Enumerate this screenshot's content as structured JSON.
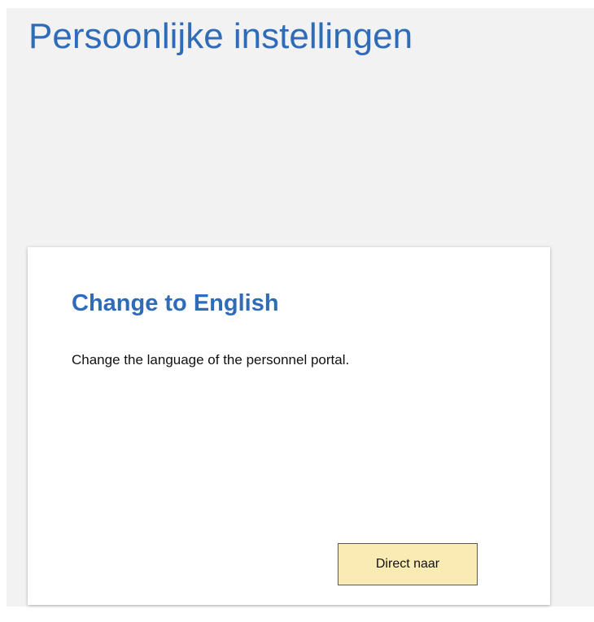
{
  "page": {
    "title": "Persoonlijke instellingen"
  },
  "tile": {
    "title": "Change to English",
    "description": "Change the language of the personnel portal.",
    "button_label": "Direct naar"
  },
  "colors": {
    "title_blue": "#2e6bb8",
    "panel_background": "#f2f2f2",
    "button_background": "#f9ebb3"
  }
}
